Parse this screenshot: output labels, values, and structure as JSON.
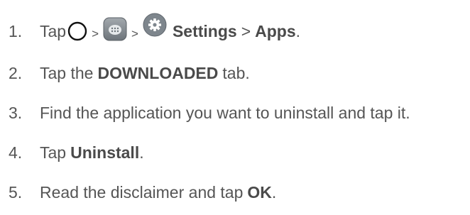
{
  "steps": [
    {
      "number": "1.",
      "parts": {
        "tap": "Tap",
        "sep1": ">",
        "sep2": ">",
        "settings": "Settings",
        "sep3": ">",
        "apps": "Apps",
        "end": "."
      },
      "icons": [
        "home-circle-icon",
        "apps-grid-icon",
        "settings-gear-icon"
      ]
    },
    {
      "number": "2.",
      "pre": "Tap the",
      "bold": "DOWNLOADED",
      "post": "tab."
    },
    {
      "number": "3.",
      "text": "Find the application you want to uninstall and tap it."
    },
    {
      "number": "4.",
      "pre": "Tap",
      "bold": "Uninstall",
      "post": "."
    },
    {
      "number": "5.",
      "pre": "Read the disclaimer and tap",
      "bold": "OK",
      "post": "."
    }
  ],
  "colors": {
    "text": "#555555",
    "icon_gray": "#8a9096",
    "icon_dark": "#5f666d"
  }
}
